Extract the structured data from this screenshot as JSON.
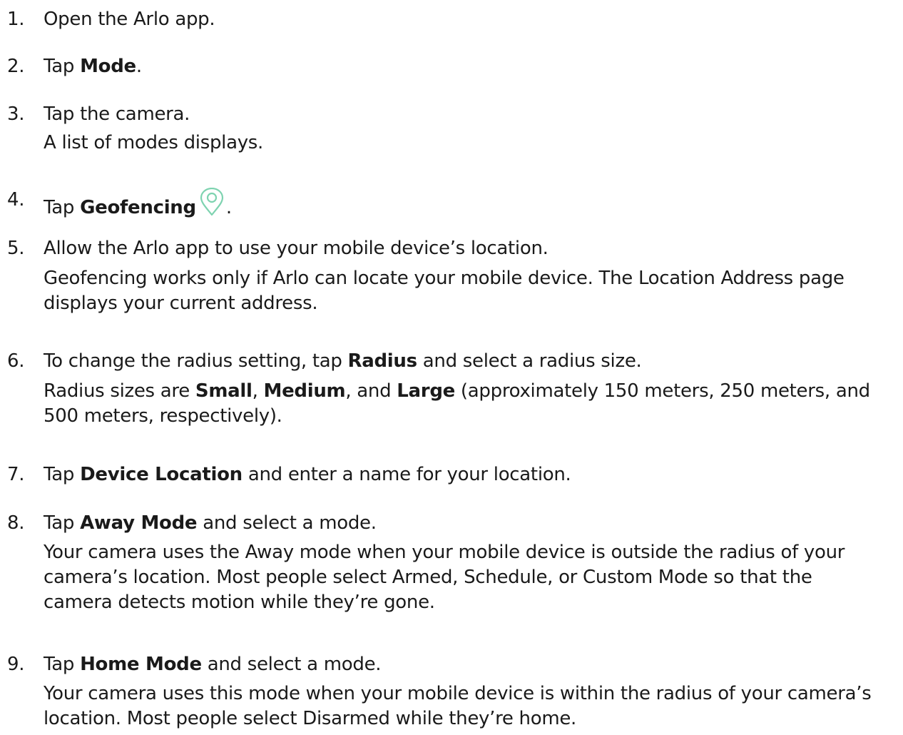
{
  "steps": [
    {
      "number": "1.",
      "text": "Open the Arlo app."
    },
    {
      "number": "2.",
      "pre": "Tap ",
      "bold": "Mode",
      "post": "."
    },
    {
      "number": "3.",
      "text": "Tap the camera.",
      "note": "A list of modes displays."
    },
    {
      "number": "4.",
      "pre": "Tap ",
      "bold": "Geofencing",
      "post": ".",
      "icon": "location-pin-icon",
      "icon_color": "#7ed3b0"
    },
    {
      "number": "5.",
      "text": "Allow the Arlo app to use your mobile device’s location.",
      "note_lines": [
        "Geofencing works only if Arlo can locate your mobile device. The Location Address page",
        "displays your current address."
      ]
    },
    {
      "number": "6.",
      "pre": "To change the radius setting, tap ",
      "bold": "Radius",
      "post": " and select a radius size.",
      "note_parts": {
        "t1": "Radius sizes are ",
        "b1": "Small",
        "t2": ", ",
        "b2": "Medium",
        "t3": ", and ",
        "b3": "Large",
        "t4": " (approximately 150 meters, 250 meters, and",
        "t5": "500 meters, respectively)."
      }
    },
    {
      "number": "7.",
      "pre": "Tap ",
      "bold": "Device Location",
      "post": " and enter a name for your location."
    },
    {
      "number": "8.",
      "pre": "Tap ",
      "bold": "Away Mode",
      "post": " and select a mode.",
      "note_lines": [
        "Your camera uses the Away mode when your mobile device is outside the radius of your",
        "camera’s location. Most people select Armed, Schedule, or Custom Mode so that the",
        "camera detects motion while they’re gone."
      ]
    },
    {
      "number": "9.",
      "pre": "Tap ",
      "bold": "Home Mode",
      "post": " and select a mode.",
      "note_lines": [
        "Your camera uses this mode when your mobile device is within the radius of your camera’s",
        "location. Most people select Disarmed while they’re home."
      ]
    }
  ]
}
